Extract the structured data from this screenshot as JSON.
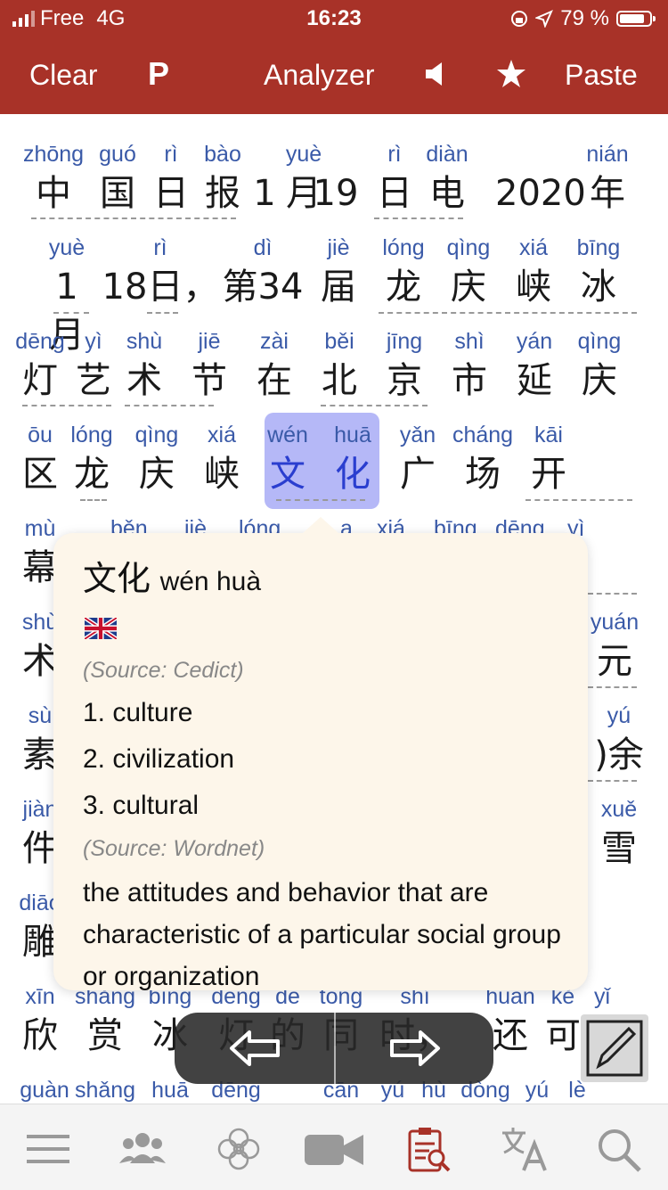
{
  "status_bar": {
    "carrier": "Free",
    "network": "4G",
    "time": "16:23",
    "battery": "79 %"
  },
  "nav": {
    "clear": "Clear",
    "p": "P",
    "title": "Analyzer",
    "paste": "Paste"
  },
  "tokens": [
    {
      "py": "zhōng",
      "hz": "中"
    },
    {
      "py": "guó",
      "hz": "国"
    },
    {
      "py": "rì",
      "hz": "日"
    },
    {
      "py": "bào",
      "hz": "报"
    },
    {
      "py": "",
      "hz": "1"
    },
    {
      "py": "yuè",
      "hz": "月"
    },
    {
      "py": "",
      "hz": "19"
    },
    {
      "py": "rì",
      "hz": "日"
    },
    {
      "py": "diàn",
      "hz": "电"
    },
    {
      "py": "",
      "hz": "2020"
    },
    {
      "py": "nián",
      "hz": "年"
    },
    {
      "py": "yuè",
      "hz": "1 月"
    },
    {
      "py": "rì",
      "hz": "18日，"
    },
    {
      "py": "dì",
      "hz": "第34"
    },
    {
      "py": "jiè",
      "hz": "届"
    },
    {
      "py": "lóng",
      "hz": "龙"
    },
    {
      "py": "qìng",
      "hz": "庆"
    },
    {
      "py": "xiá",
      "hz": "峡"
    },
    {
      "py": "bīng",
      "hz": "冰"
    },
    {
      "py": "dēng",
      "hz": "灯"
    },
    {
      "py": "yì",
      "hz": "艺"
    },
    {
      "py": "shù",
      "hz": "术"
    },
    {
      "py": "jiē",
      "hz": "节"
    },
    {
      "py": "zài",
      "hz": "在"
    },
    {
      "py": "běi",
      "hz": "北"
    },
    {
      "py": "jīng",
      "hz": "京"
    },
    {
      "py": "shì",
      "hz": "市"
    },
    {
      "py": "yán",
      "hz": "延"
    },
    {
      "py": "qìng",
      "hz": "庆"
    },
    {
      "py": "ōu",
      "hz": "区"
    },
    {
      "py": "lóng",
      "hz": "龙"
    },
    {
      "py": "qìng",
      "hz": "庆"
    },
    {
      "py": "xiá",
      "hz": "峡"
    },
    {
      "py": "wén",
      "hz": "文"
    },
    {
      "py": "huā",
      "hz": "化"
    },
    {
      "py": "yǎn",
      "hz": "广"
    },
    {
      "py": "cháng",
      "hz": "场"
    },
    {
      "py": "kāi",
      "hz": "开"
    },
    {
      "py": "mù",
      "hz": "幕"
    },
    {
      "py": "shù",
      "hz": "术"
    },
    {
      "py": "yuán",
      "hz": "元"
    },
    {
      "py": "sù",
      "hz": "素"
    },
    {
      "py": "yú",
      "hz": ")余"
    },
    {
      "py": "jiàn",
      "hz": "件"
    },
    {
      "py": "xuě",
      "hz": "雪"
    },
    {
      "py": "diāo",
      "hz": "雕"
    },
    {
      "py": "xīn",
      "hz": "欣"
    },
    {
      "py": "shǎng",
      "hz": "赏"
    },
    {
      "py": "bīng",
      "hz": "冰"
    },
    {
      "py": "dēng",
      "hz": "灯"
    },
    {
      "py": "de",
      "hz": "的"
    },
    {
      "py": "tóng",
      "hz": "同"
    },
    {
      "py": "shí",
      "hz": "时，"
    },
    {
      "py": "huán",
      "hz": "还"
    },
    {
      "py": "kě",
      "hz": "可"
    },
    {
      "py": "yǐ",
      "hz": ""
    },
    {
      "py": "guàn",
      "hz": ""
    },
    {
      "py": "shǎng",
      "hz": ""
    },
    {
      "py": "huā",
      "hz": ""
    },
    {
      "py": "dēng",
      "hz": ""
    },
    {
      "py": "cān",
      "hz": ""
    },
    {
      "py": "yú",
      "hz": ""
    },
    {
      "py": "hù",
      "hz": ""
    },
    {
      "py": "dòng",
      "hz": ""
    },
    {
      "py": "yú",
      "hz": ""
    },
    {
      "py": "lè",
      "hz": ""
    }
  ],
  "hidden_row_py": [
    "běn",
    "jiè",
    "lóng",
    "a",
    "xiá",
    "bīng",
    "dēng",
    "yì"
  ],
  "popup": {
    "word": "文化",
    "pinyin": "wén huà",
    "source1": "(Source: Cedict)",
    "defs": [
      "1. culture",
      "2. civilization",
      "3. cultural"
    ],
    "source2": "(Source: Wordnet)",
    "long": "the attitudes and behavior that are characteristic of a particular social group or organization"
  },
  "icons": {
    "tabs": [
      "menu-icon",
      "people-icon",
      "flower-icon",
      "video-icon",
      "analyzer-icon",
      "translate-icon",
      "search-icon"
    ]
  },
  "colors": {
    "brand": "#a83228",
    "pinyin": "#3a5aa8",
    "highlight": "#b5b8f7",
    "active_tab": "#a83228"
  }
}
